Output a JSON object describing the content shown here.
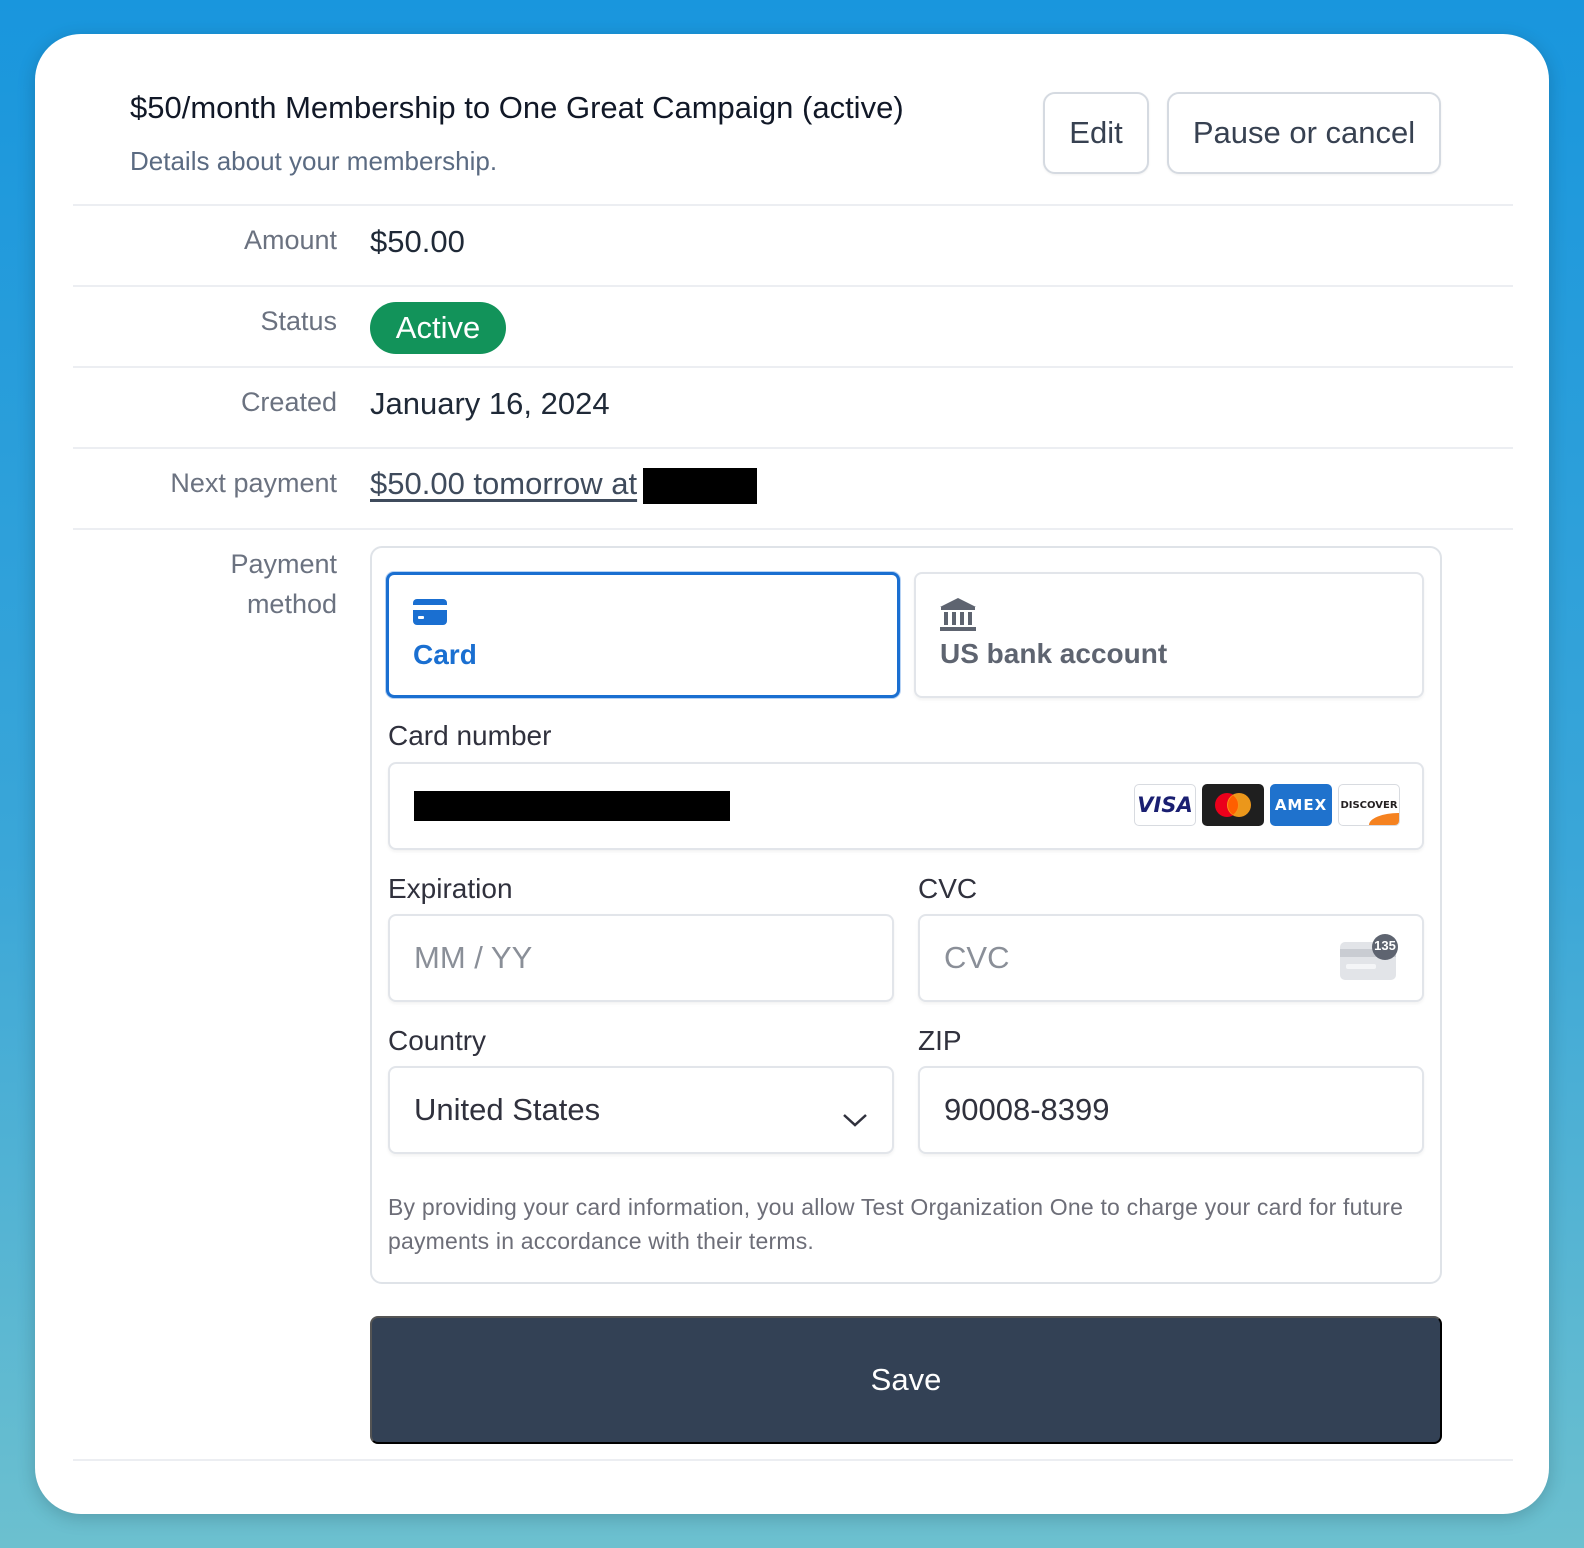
{
  "header": {
    "title": "$50/month Membership to One Great Campaign (active)",
    "subtitle": "Details about your membership.",
    "edit_label": "Edit",
    "pause_label": "Pause or cancel"
  },
  "details": {
    "amount_label": "Amount",
    "amount_value": "$50.00",
    "status_label": "Status",
    "status_value": "Active",
    "status_color": "#12935a",
    "created_label": "Created",
    "created_value": "January 16, 2024",
    "next_payment_label": "Next payment",
    "next_payment_value": "$50.00 tomorrow at",
    "payment_method_label_1": "Payment",
    "payment_method_label_2": "method"
  },
  "payment": {
    "tabs": [
      {
        "label": "Card",
        "icon": "credit-card-icon",
        "selected": true
      },
      {
        "label": "US bank account",
        "icon": "bank-icon",
        "selected": false
      }
    ],
    "card_number_label": "Card number",
    "brands": [
      "VISA",
      "mastercard",
      "AMEX",
      "DISCOVER"
    ],
    "expiration_label": "Expiration",
    "expiration_placeholder": "MM / YY",
    "cvc_label": "CVC",
    "cvc_placeholder": "CVC",
    "cvc_badge": "135",
    "country_label": "Country",
    "country_value": "United States",
    "zip_label": "ZIP",
    "zip_value": "90008-8399",
    "disclaimer": "By providing your card information, you allow Test Organization One to charge your card for future payments in accordance with their terms."
  },
  "save_label": "Save",
  "colors": {
    "accent": "#1a6fd1",
    "save_button": "#334155",
    "status_badge": "#12935a"
  }
}
